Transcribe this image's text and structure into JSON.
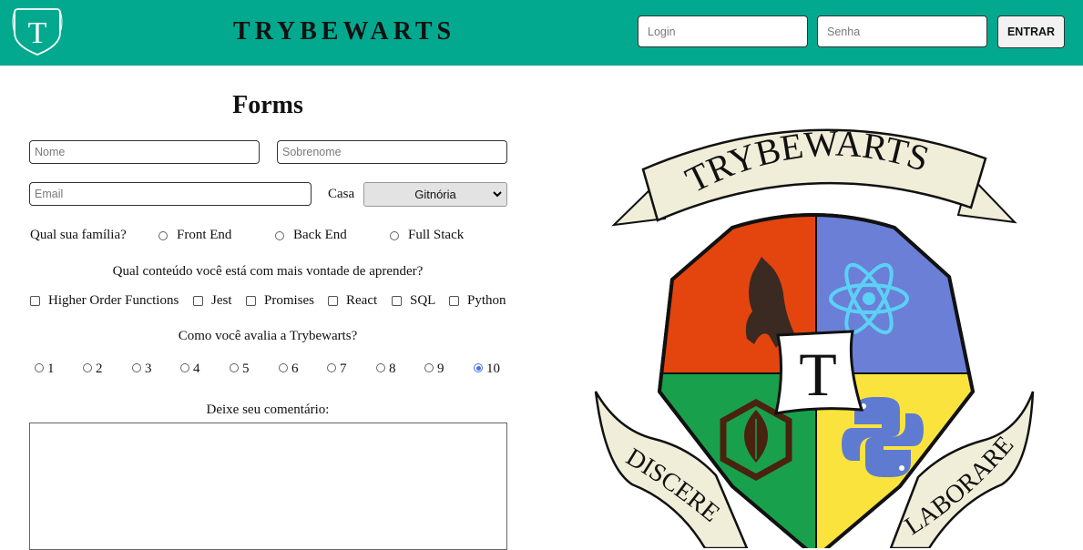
{
  "header": {
    "logo_letter": "T",
    "brand": "TRYBEWARTS",
    "login_placeholder": "Login",
    "password_placeholder": "Senha",
    "enter_label": "ENTRAR",
    "background_color": "#03a98f"
  },
  "form": {
    "title": "Forms",
    "name_placeholder": "Nome",
    "surname_placeholder": "Sobrenome",
    "email_placeholder": "Email",
    "house_label": "Casa",
    "house_selected": "Gitnória",
    "family_question": "Qual sua família?",
    "family_options": [
      "Front End",
      "Back End",
      "Full Stack"
    ],
    "content_question": "Qual conteúdo você está com mais vontade de aprender?",
    "content_options": [
      "Higher Order Functions",
      "Jest",
      "Promises",
      "React",
      "SQL",
      "Python"
    ],
    "rating_question": "Como você avalia a Trybewarts?",
    "rating_options": [
      "1",
      "2",
      "3",
      "4",
      "5",
      "6",
      "7",
      "8",
      "9",
      "10"
    ],
    "rating_selected": "10",
    "comment_label": "Deixe seu comentário:"
  },
  "crest": {
    "banner_text": "TRYBEWARTS",
    "center_letter": "T",
    "motto_left": "DISCERE",
    "motto_right": "LABORARE",
    "colors": {
      "red": "#e4450e",
      "blue": "#6b7fd7",
      "green": "#19a04c",
      "yellow": "#fae33c",
      "scroll": "#f0eed8"
    }
  }
}
